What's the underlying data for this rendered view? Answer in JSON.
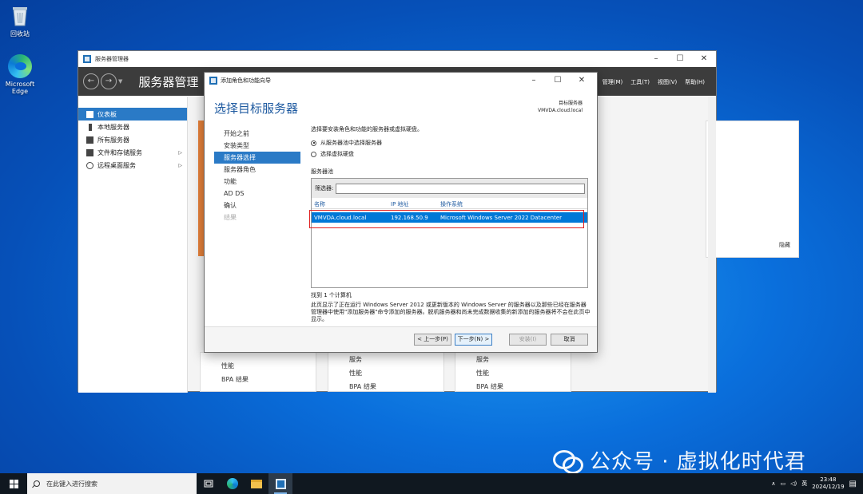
{
  "desktop": {
    "recycle_bin": "回收站",
    "edge": "Microsoft Edge"
  },
  "server_manager": {
    "window_title": "服务器管理器",
    "header_title": "服务器管理",
    "menus": [
      "管理(M)",
      "工具(T)",
      "视图(V)",
      "帮助(H)"
    ],
    "nav": [
      {
        "label": "仪表板",
        "active": true
      },
      {
        "label": "本地服务器",
        "active": false
      },
      {
        "label": "所有服务器",
        "active": false
      },
      {
        "label": "文件和存储服务",
        "active": false,
        "arrow": "▷"
      },
      {
        "label": "远程桌面服务",
        "active": false,
        "arrow": "▷"
      }
    ],
    "hide_label": "隐藏",
    "tiles": [
      [
        "性能",
        "BPA 结果"
      ],
      [
        "服务",
        "性能",
        "BPA 结果"
      ],
      [
        "服务",
        "性能",
        "BPA 结果"
      ]
    ]
  },
  "wizard": {
    "title": "添加角色和功能向导",
    "heading": "选择目标服务器",
    "dest_label": "目标服务器",
    "dest_value": "VMVDA.cloud.local",
    "steps": [
      {
        "label": "开始之前",
        "state": "normal"
      },
      {
        "label": "安装类型",
        "state": "normal"
      },
      {
        "label": "服务器选择",
        "state": "active"
      },
      {
        "label": "服务器角色",
        "state": "normal"
      },
      {
        "label": "功能",
        "state": "normal"
      },
      {
        "label": "AD DS",
        "state": "normal"
      },
      {
        "label": "确认",
        "state": "normal"
      },
      {
        "label": "结果",
        "state": "disabled"
      }
    ],
    "description": "选择要安装角色和功能的服务器或虚拟硬盘。",
    "radio_pool": "从服务器池中选择服务器",
    "radio_vhd": "选择虚拟硬盘",
    "pool_label": "服务器池",
    "filter_label": "筛选器:",
    "filter_value": "",
    "columns": [
      "名称",
      "IP 地址",
      "操作系统"
    ],
    "rows": [
      {
        "name": "VMVDA.cloud.local",
        "ip": "192.168.50.9",
        "os": "Microsoft Windows Server 2022 Datacenter"
      }
    ],
    "found": "找到 1 个计算机",
    "note": "此页显示了正在运行 Windows Server 2012 或更新版本的 Windows Server 的服务器以及那些已经在服务器管理器中使用\"添加服务器\"命令添加的服务器。脱机服务器和尚未完成数据收集的新添加的服务器将不会在此页中显示。",
    "buttons": {
      "prev": "< 上一步(P)",
      "next": "下一步(N) >",
      "install": "安装(I)",
      "cancel": "取消"
    }
  },
  "watermark": "公众号 · 虚拟化时代君",
  "taskbar": {
    "search_placeholder": "在此键入进行搜索",
    "tray_lang": "英",
    "time": "23:48",
    "date": "2024/12/19"
  },
  "colors": {
    "accent": "#2a7ac6",
    "selection": "#0078d7",
    "highlight_box": "#e02020"
  }
}
